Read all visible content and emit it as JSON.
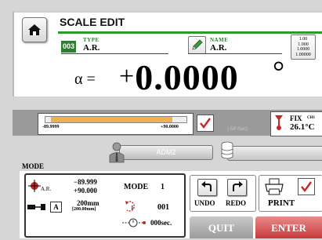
{
  "header": {
    "title": "SCALE EDIT"
  },
  "type_field": {
    "badge": "003",
    "label": "TYPE",
    "value": "A.R."
  },
  "name_field": {
    "label": "NAME",
    "value": "A.R."
  },
  "resolution": {
    "options": [
      "1.00",
      "1.000",
      "1.0000",
      "1.00000"
    ]
  },
  "display": {
    "symbol": "α =",
    "sign": "+",
    "value": "0.0000",
    "unit": "°"
  },
  "range": {
    "min": "-89.9999",
    "max": "+90.0000",
    "checked": true,
    "speed": "(-58°/sec)"
  },
  "temperature": {
    "label": "FIX",
    "channel": "CH1",
    "value": "26.1°C"
  },
  "operator": {
    "name": "ADM2"
  },
  "mode": {
    "label": "MODE",
    "axis_label": "A.R.",
    "range_max_neg": "−89.999",
    "range_max_pos": "+90.000",
    "mode_label": "MODE",
    "mode_value": "1",
    "sub_badge": "A",
    "length_value": "200mm",
    "length_sub": "[200.00mm]",
    "count_value": "001",
    "time_value": "000sec."
  },
  "actions": {
    "undo": "UNDO",
    "redo": "REDO",
    "print": "PRINT",
    "print_checked": true,
    "quit": "QUIT",
    "enter": "ENTER"
  }
}
